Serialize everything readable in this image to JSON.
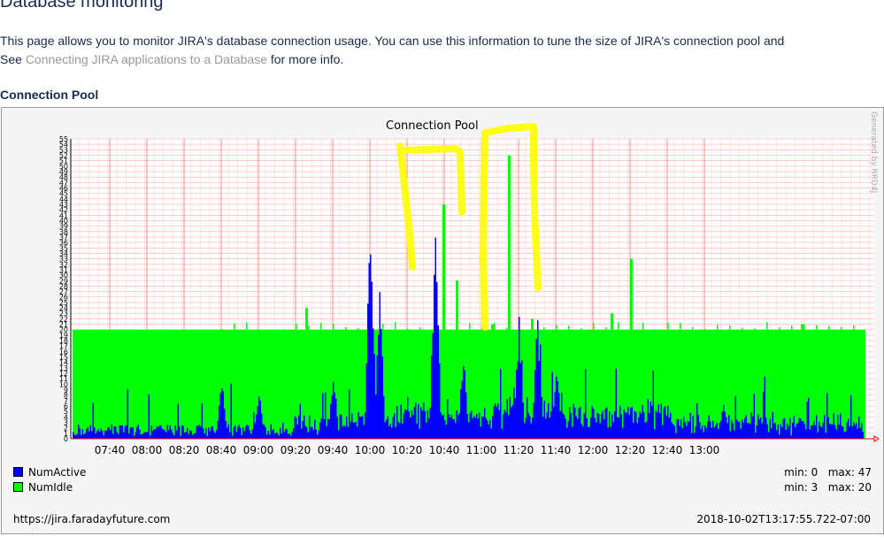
{
  "page": {
    "title": "Database monitoring",
    "intro_line1": "This page allows you to monitor JIRA's database connection usage. You can use this information to tune the size of JIRA's connection pool and",
    "intro_line2_prefix": "See ",
    "intro_link": "Connecting JIRA applications to a Database",
    "intro_line2_suffix": " for more info.",
    "section_title": "Connection Pool"
  },
  "chart_data": {
    "type": "area",
    "title": "Connection Pool",
    "watermark": "Generated by RRD4J",
    "x_ticks": [
      "07:40",
      "08:00",
      "08:20",
      "08:40",
      "09:00",
      "09:20",
      "09:40",
      "10:00",
      "10:20",
      "10:40",
      "11:00",
      "11:20",
      "11:40",
      "12:00",
      "12:20",
      "12:40",
      "13:00"
    ],
    "ylim": [
      0,
      55
    ],
    "y_ticks": [
      0,
      1,
      2,
      3,
      4,
      5,
      6,
      7,
      8,
      9,
      10,
      11,
      12,
      13,
      14,
      15,
      16,
      17,
      18,
      19,
      20,
      21,
      22,
      23,
      24,
      25,
      26,
      27,
      28,
      29,
      30,
      31,
      32,
      33,
      34,
      35,
      36,
      37,
      38,
      39,
      40,
      41,
      42,
      43,
      44,
      45,
      46,
      47,
      48,
      49,
      50,
      51,
      52,
      53,
      54,
      55
    ],
    "series": [
      {
        "name": "NumActive",
        "color": "#0000ff",
        "min": 0,
        "max": 47,
        "min_label": "min: 0",
        "max_label": "max: 47",
        "peaks": [
          {
            "x": "07:40",
            "y": 2
          },
          {
            "x": "08:40",
            "y": 12
          },
          {
            "x": "09:00",
            "y": 9
          },
          {
            "x": "09:40",
            "y": 13
          },
          {
            "x": "10:00",
            "y": 44
          },
          {
            "x": "10:05",
            "y": 27
          },
          {
            "x": "10:20",
            "y": 8
          },
          {
            "x": "10:35",
            "y": 45
          },
          {
            "x": "10:50",
            "y": 16
          },
          {
            "x": "11:20",
            "y": 23
          },
          {
            "x": "11:30",
            "y": 24
          },
          {
            "x": "11:40",
            "y": 12
          },
          {
            "x": "12:00",
            "y": 5
          },
          {
            "x": "13:10",
            "y": 7
          }
        ]
      },
      {
        "name": "NumIdle",
        "color": "#00ff00",
        "min": 3,
        "max": 20,
        "min_label": "min: 3",
        "max_label": "max: 20"
      }
    ],
    "grid": true,
    "legend": "bottom-left",
    "footer_left": "https://jira.faradayfuture.com",
    "footer_right": "2018-10-02T13:17:55.722-07:00",
    "annotations": {
      "color": "#ffff00"
    }
  }
}
